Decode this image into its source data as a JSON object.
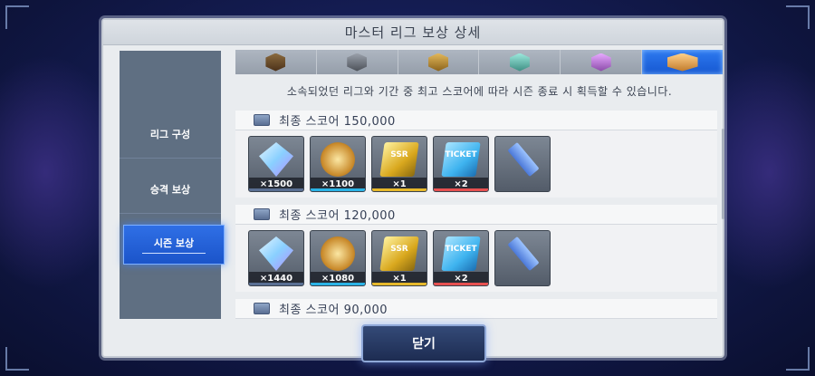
{
  "title": "마스터 리그 보상 상세",
  "sidebar": {
    "items": [
      {
        "label": "리그 구성",
        "active": false
      },
      {
        "label": "승격 보상",
        "active": false
      },
      {
        "label": "시즌 보상",
        "active": true
      }
    ]
  },
  "tiers": [
    {
      "icon": "bronze-emblem-icon",
      "color": "#6b4b2a"
    },
    {
      "icon": "silver-emblem-icon",
      "color": "#6a6f79"
    },
    {
      "icon": "gold-emblem-icon",
      "color": "#b58a2e"
    },
    {
      "icon": "platinum-emblem-icon",
      "color": "#5fb3a7"
    },
    {
      "icon": "diamond-emblem-icon",
      "color": "#b46ccf"
    },
    {
      "icon": "master-emblem-icon",
      "color": "#e8a45a",
      "active": true
    }
  ],
  "description": "소속되었던 리그와 기간 중 최고 스코어에 따라 시즌 종료 시 획득할 수 있습니다.",
  "score_blocks": [
    {
      "label": "최종 스코어 150,000",
      "rewards": [
        {
          "icon": "diamond-icon",
          "count": "×1500",
          "bar": "#5a6f93"
        },
        {
          "icon": "master-coin-icon",
          "count": "×1100",
          "bar": "#2bb3e6"
        },
        {
          "icon": "ssr-ticket-icon",
          "count": "×1",
          "bar": "#e6b82b",
          "label": "SSR"
        },
        {
          "icon": "ticket-icon",
          "count": "×2",
          "bar": "#e65050",
          "label": "TICKET"
        },
        {
          "icon": "stick-icon",
          "count": "",
          "bar": ""
        }
      ]
    },
    {
      "label": "최종 스코어 120,000",
      "rewards": [
        {
          "icon": "diamond-icon",
          "count": "×1440",
          "bar": "#5a6f93"
        },
        {
          "icon": "master-coin-icon",
          "count": "×1080",
          "bar": "#2bb3e6"
        },
        {
          "icon": "ssr-ticket-icon",
          "count": "×1",
          "bar": "#e6b82b",
          "label": "SSR"
        },
        {
          "icon": "ticket-icon",
          "count": "×2",
          "bar": "#e65050",
          "label": "TICKET"
        },
        {
          "icon": "stick-icon",
          "count": "",
          "bar": ""
        }
      ]
    },
    {
      "label": "최종 스코어 90,000",
      "rewards": []
    }
  ],
  "close_label": "닫기"
}
